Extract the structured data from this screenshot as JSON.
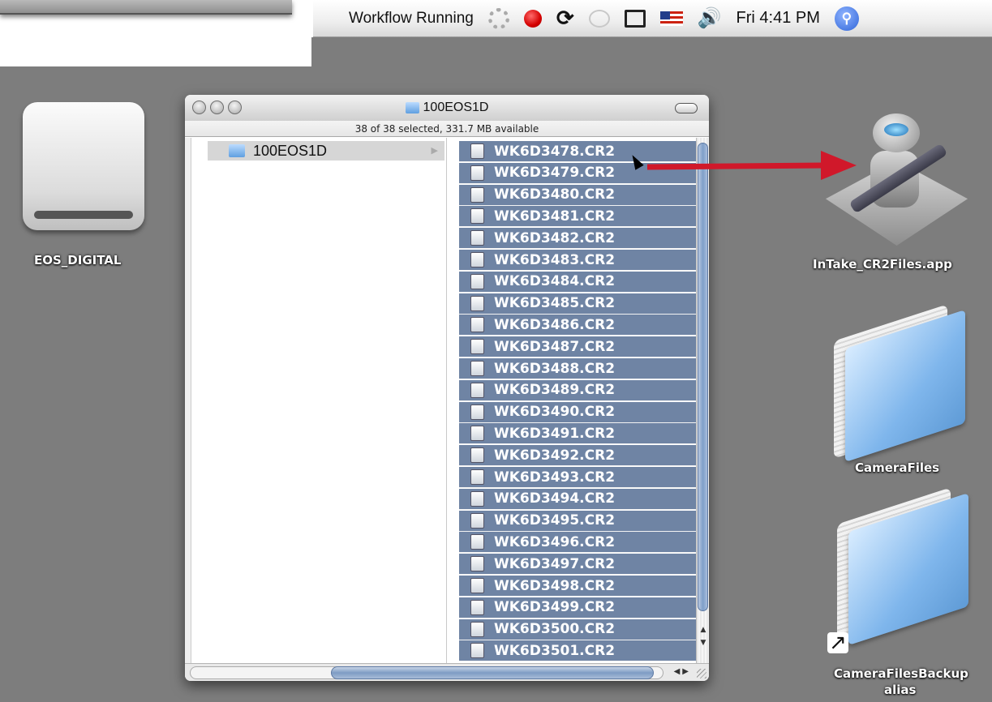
{
  "menubar": {
    "workflow_status": "Workflow Running",
    "clock": "Fri 4:41 PM",
    "icons": [
      "spinner-icon",
      "record-icon",
      "sync-icon",
      "chat-bubble-icon",
      "display-icon",
      "us-flag-icon",
      "speaker-icon",
      "spotlight-icon"
    ],
    "spotlight_glyph": "🔍"
  },
  "desktop": {
    "drive_label": "EOS_DIGITAL",
    "app_label": "InTake_CR2Files.app",
    "folder_label": "CameraFiles",
    "alias_label_line1": "CameraFilesBackup",
    "alias_label_line2": "alias",
    "alias_arrow": "↗"
  },
  "window": {
    "title": "100EOS1D",
    "status": "38 of 38 selected, 331.7 MB available",
    "column1_item": "100EOS1D",
    "column1_arrow": "▶",
    "files": [
      "WK6D3478.CR2",
      "WK6D3479.CR2",
      "WK6D3480.CR2",
      "WK6D3481.CR2",
      "WK6D3482.CR2",
      "WK6D3483.CR2",
      "WK6D3484.CR2",
      "WK6D3485.CR2",
      "WK6D3486.CR2",
      "WK6D3487.CR2",
      "WK6D3488.CR2",
      "WK6D3489.CR2",
      "WK6D3490.CR2",
      "WK6D3491.CR2",
      "WK6D3492.CR2",
      "WK6D3493.CR2",
      "WK6D3494.CR2",
      "WK6D3495.CR2",
      "WK6D3496.CR2",
      "WK6D3497.CR2",
      "WK6D3498.CR2",
      "WK6D3499.CR2",
      "WK6D3500.CR2",
      "WK6D3501.CR2"
    ],
    "scroll_up": "▲",
    "scroll_down": "▼",
    "h_arrows": "◀▶"
  },
  "colors": {
    "selection": "#6f84a4",
    "desktop": "#7d7d7d",
    "arrow": "#d0182a"
  }
}
